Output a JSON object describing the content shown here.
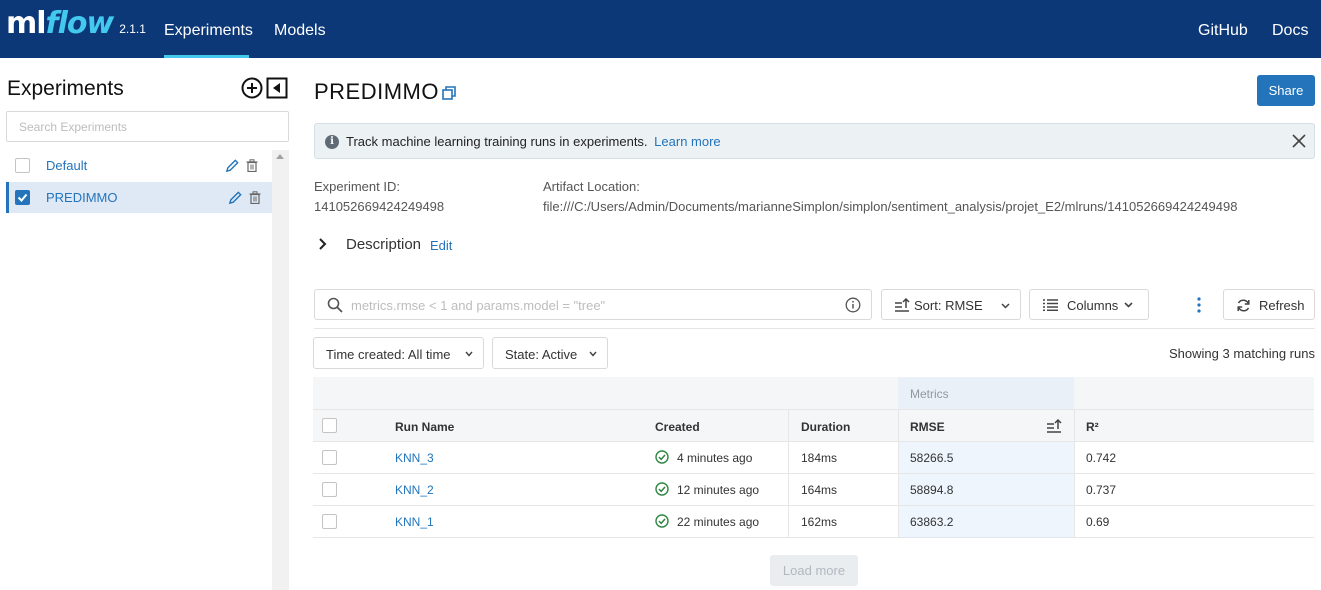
{
  "header": {
    "logo_ml": "ml",
    "logo_flow": "flow",
    "version": "2.1.1",
    "nav": {
      "experiments": "Experiments",
      "models": "Models",
      "github": "GitHub",
      "docs": "Docs"
    }
  },
  "sidebar": {
    "title": "Experiments",
    "search_placeholder": "Search Experiments",
    "items": [
      {
        "label": "Default",
        "checked": false
      },
      {
        "label": "PREDIMMO",
        "checked": true
      }
    ]
  },
  "experiment": {
    "title": "PREDIMMO",
    "share_label": "Share",
    "info": {
      "text": "Track machine learning training runs in experiments.",
      "link": "Learn more"
    },
    "id_label": "Experiment ID:",
    "id_value": "141052669424249498",
    "artifact_label": "Artifact Location:",
    "artifact_value": "file:///C:/Users/Admin/Documents/marianneSimplon/simplon/sentiment_analysis/projet_E2/mlruns/141052669424249498",
    "description_label": "Description",
    "description_edit": "Edit"
  },
  "toolbar": {
    "search_placeholder": "metrics.rmse < 1 and params.model = \"tree\"",
    "sort_label": "Sort: RMSE",
    "columns_label": "Columns",
    "refresh_label": "Refresh",
    "time_filter": "Time created: All time",
    "state_filter": "State: Active",
    "matching": "Showing 3 matching runs"
  },
  "table": {
    "group_header": "Metrics",
    "columns": {
      "run_name": "Run Name",
      "created": "Created",
      "duration": "Duration",
      "rmse": "RMSE",
      "r2": "R²"
    },
    "rows": [
      {
        "run_name": "KNN_3",
        "created": "4 minutes ago",
        "duration": "184ms",
        "rmse": "58266.5",
        "r2": "0.742"
      },
      {
        "run_name": "KNN_2",
        "created": "12 minutes ago",
        "duration": "164ms",
        "rmse": "58894.8",
        "r2": "0.737"
      },
      {
        "run_name": "KNN_1",
        "created": "22 minutes ago",
        "duration": "162ms",
        "rmse": "63863.2",
        "r2": "0.69"
      }
    ],
    "load_more": "Load more"
  },
  "colors": {
    "header_bg": "#0c3878",
    "accent": "#43c9ed",
    "link": "#2374bb",
    "success": "#2e8540"
  }
}
